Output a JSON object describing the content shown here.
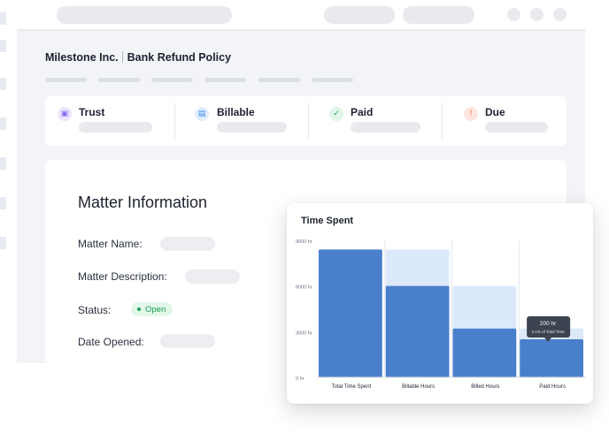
{
  "header": {
    "company": "Milestone Inc.",
    "page_title": "Bank Refund Policy"
  },
  "summary": {
    "items": [
      {
        "label": "Trust",
        "icon": "wallet-icon",
        "color": "#8b6cf0"
      },
      {
        "label": "Billable",
        "icon": "receipt-icon",
        "color": "#3b8cf0"
      },
      {
        "label": "Paid",
        "icon": "check-icon",
        "color": "#22a85a"
      },
      {
        "label": "Due",
        "icon": "alert-icon",
        "color": "#f06a4a"
      }
    ]
  },
  "matter": {
    "title": "Matter Information",
    "fields": {
      "name_label": "Matter Name:",
      "description_label": "Matter Description:",
      "status_label": "Status:",
      "status_value": "Open",
      "date_label": "Date Opened:"
    }
  },
  "chart_data": {
    "type": "bar",
    "title": "Time Spent",
    "categories": [
      "Total Time Spent",
      "Billable Hours",
      "Billed Hours",
      "Paid Hours"
    ],
    "y_tick_labels": [
      "0 hr",
      "3000 hr",
      "6000 hr",
      "9000 hr"
    ],
    "y_ticks": [
      0,
      3000,
      6000,
      9000
    ],
    "ylim": [
      0,
      9000
    ],
    "series": [
      {
        "values": [
          8400,
          8400,
          6000,
          3200
        ],
        "color": "#dce9fb"
      },
      {
        "values": [
          8400,
          6000,
          3200,
          2500
        ],
        "color": "#4a7fcc"
      }
    ],
    "grid": "vertical separators",
    "tooltip": {
      "title": "200 hr",
      "subtitle": "3.1% of Total Time",
      "category": "Paid Hours"
    }
  }
}
